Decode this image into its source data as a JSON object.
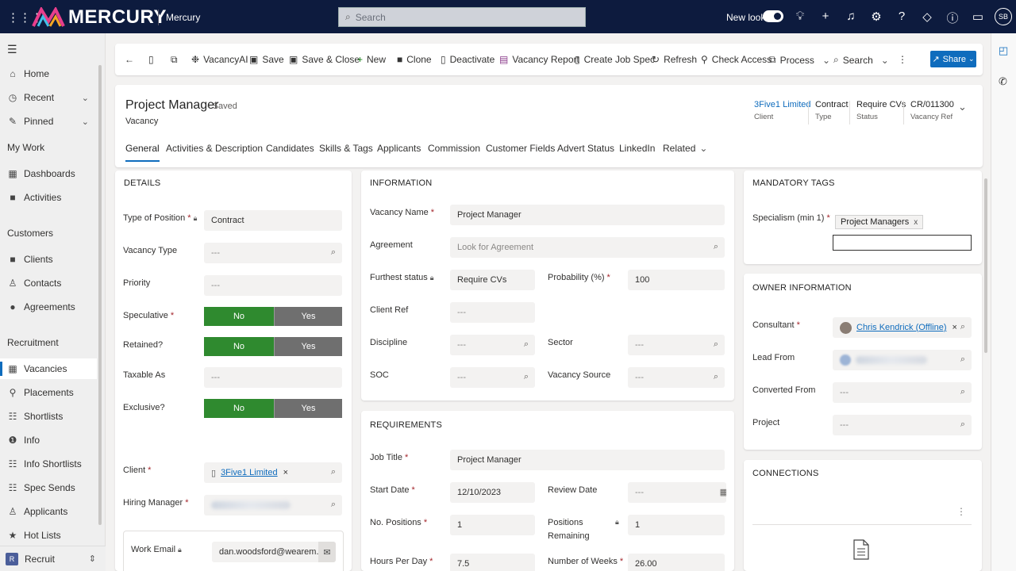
{
  "topbar": {
    "brand": "MERCURY",
    "app_name": "Mercury",
    "search_placeholder": "Search",
    "new_look_label": "New look",
    "avatar_initials": "SB"
  },
  "sidebar": {
    "top_items": [
      {
        "label": "Home",
        "icon": "home-icon"
      },
      {
        "label": "Recent",
        "icon": "clock-icon"
      },
      {
        "label": "Pinned",
        "icon": "pin-icon"
      }
    ],
    "my_work_head": "My Work",
    "my_work": [
      {
        "label": "Dashboards"
      },
      {
        "label": "Activities"
      }
    ],
    "customers_head": "Customers",
    "customers": [
      {
        "label": "Clients"
      },
      {
        "label": "Contacts"
      },
      {
        "label": "Agreements"
      }
    ],
    "recruitment_head": "Recruitment",
    "recruitment": [
      {
        "label": "Vacancies"
      },
      {
        "label": "Placements"
      },
      {
        "label": "Shortlists"
      },
      {
        "label": "Info"
      },
      {
        "label": "Info Shortlists"
      },
      {
        "label": "Spec Sends"
      },
      {
        "label": "Applicants"
      },
      {
        "label": "Hot Lists"
      }
    ],
    "area_badge": "R",
    "area_label": "Recruit"
  },
  "commands": {
    "vacancy_ai": "VacancyAI",
    "save": "Save",
    "save_close": "Save & Close",
    "new": "New",
    "clone": "Clone",
    "deactivate": "Deactivate",
    "vacancy_report": "Vacancy Report",
    "create_job_spec": "Create Job Spec",
    "refresh": "Refresh",
    "check_access": "Check Access",
    "process": "Process",
    "search": "Search",
    "share": "Share"
  },
  "record": {
    "title": "Project Manager",
    "saved": "- Saved",
    "entity": "Vacancy",
    "header_fields": [
      {
        "value": "3Five1 Limited",
        "label": "Client"
      },
      {
        "value": "Contract",
        "label": "Type"
      },
      {
        "value": "Require CVs",
        "label": "Status"
      },
      {
        "value": "CR/011300",
        "label": "Vacancy Ref"
      }
    ],
    "tabs": [
      "General",
      "Activities & Description",
      "Candidates",
      "Skills & Tags",
      "Applicants",
      "Commission",
      "Customer Fields",
      "Advert Status",
      "LinkedIn",
      "Related"
    ]
  },
  "details": {
    "title": "DETAILS",
    "type_of_position_label": "Type of Position",
    "type_of_position": "Contract",
    "vacancy_type_label": "Vacancy Type",
    "empty": "---",
    "priority_label": "Priority",
    "speculative_label": "Speculative",
    "retained_label": "Retained?",
    "taxable_label": "Taxable As",
    "exclusive_label": "Exclusive?",
    "no": "No",
    "yes": "Yes",
    "client_label": "Client",
    "client": "3Five1 Limited",
    "hiring_manager_label": "Hiring Manager",
    "work_email_label": "Work Email",
    "work_email": "dan.woodsford@wearem..."
  },
  "information": {
    "title": "INFORMATION",
    "vacancy_name_label": "Vacancy Name",
    "vacancy_name": "Project Manager",
    "agreement_label": "Agreement",
    "agreement_placeholder": "Look for Agreement",
    "furthest_status_label": "Furthest status",
    "furthest_status": "Require CVs",
    "probability_label": "Probability (%)",
    "probability": "100",
    "client_ref_label": "Client Ref",
    "discipline_label": "Discipline",
    "sector_label": "Sector",
    "soc_label": "SOC",
    "vacancy_source_label": "Vacancy Source"
  },
  "requirements": {
    "title": "REQUIREMENTS",
    "job_title_label": "Job Title",
    "job_title": "Project Manager",
    "start_date_label": "Start Date",
    "start_date": "12/10/2023",
    "review_date_label": "Review Date",
    "no_positions_label": "No. Positions",
    "no_positions": "1",
    "positions_remaining_label_1": "Positions",
    "positions_remaining_label_2": "Remaining",
    "positions_remaining": "1",
    "hours_per_day_label": "Hours Per Day",
    "hours_per_day": "7.5",
    "weeks_label": "Number of Weeks",
    "weeks": "26.00"
  },
  "mandatory_tags": {
    "title": "MANDATORY TAGS",
    "specialism_label": "Specialism (min 1)",
    "tag": "Project Managers"
  },
  "owner": {
    "title": "OWNER INFORMATION",
    "consultant_label": "Consultant",
    "consultant": "Chris Kendrick (Offline)",
    "lead_from_label": "Lead From",
    "converted_from_label": "Converted From",
    "project_label": "Project"
  },
  "connections": {
    "title": "CONNECTIONS"
  }
}
